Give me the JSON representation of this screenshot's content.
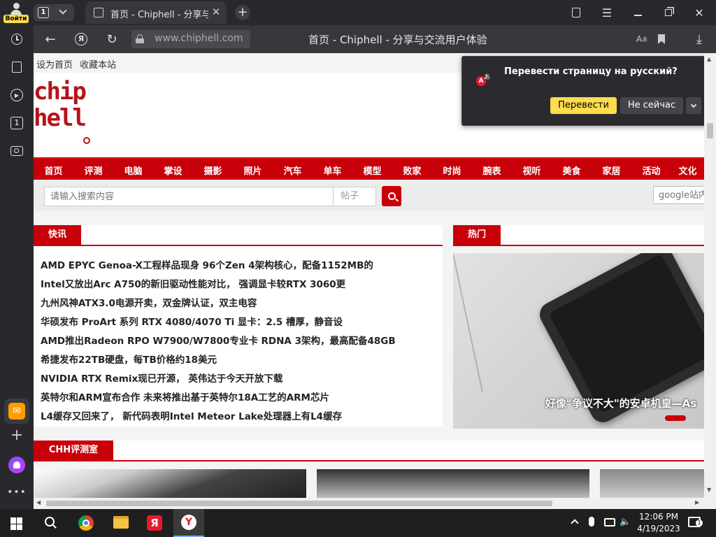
{
  "top": {
    "login_label": "Войти",
    "tab_count": "1",
    "tab_title": "首页 - Chiphell - 分享与"
  },
  "address": {
    "url": "www.chiphell.com",
    "page_title": "首页 - Chiphell - 分享与交流用户体验"
  },
  "site": {
    "toplinks": [
      "设为首页",
      "收藏本站"
    ],
    "logo_top": "chip",
    "logo_bottom": "hell",
    "nav": [
      "首页",
      "评测",
      "电脑",
      "掌设",
      "摄影",
      "照片",
      "汽车",
      "单车",
      "模型",
      "败家",
      "时尚",
      "腕表",
      "视听",
      "美食",
      "家居",
      "活动",
      "文化"
    ],
    "search_placeholder": "请输入搜索内容",
    "search_type": "帖子",
    "google_placeholder": "google站内",
    "news_heading": "快讯",
    "hot_heading": "热门",
    "chh_heading": "CHH评测室",
    "hot_caption": "好像\"争议不大\"的安卓机皇—As",
    "news": [
      "AMD EPYC Genoa-X工程样品现身 96个Zen 4架构核心，配备1152MB的",
      "Intel又放出Arc A750的新旧驱动性能对比， 强调显卡较RTX 3060更",
      "九州风神ATX3.0电源开卖，双金牌认证，双主电容",
      "华硕发布 ProArt 系列 RTX 4080/4070 Ti 显卡：2.5 槽厚，静音设",
      "AMD推出Radeon RPO W7900/W7800专业卡 RDNA 3架构，最高配备48GB",
      "希捷发布22TB硬盘，每TB价格约18美元",
      "NVIDIA RTX Remix现已开源， 英伟达于今天开放下载",
      "英特尔和ARM宣布合作 未来将推出基于英特尔18A工艺的ARM芯片",
      "L4缓存又回来了， 新代码表明Intel Meteor Lake处理器上有L4缓存"
    ]
  },
  "translate": {
    "title": "Перевести страницу на русский?",
    "translate_btn": "Перевести",
    "not_now_btn": "Не сейчас"
  },
  "taskbar": {
    "time": "12:06 PM",
    "date": "4/19/2023"
  },
  "colors": {
    "accent_red": "#c8000a",
    "translate_yellow": "#ffdb4d"
  }
}
